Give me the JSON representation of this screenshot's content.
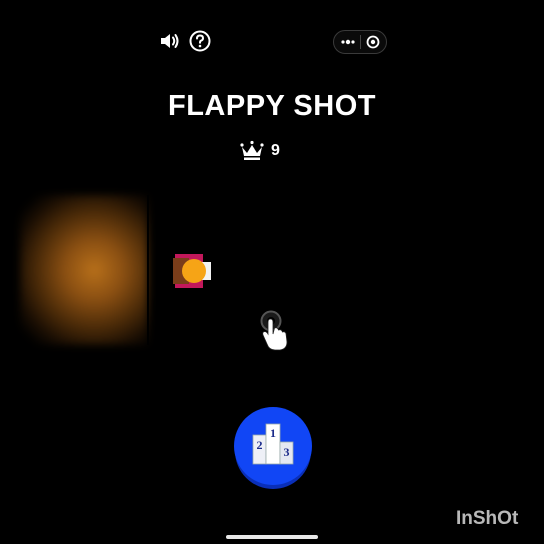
{
  "topbar": {
    "sound_icon": "speaker-icon",
    "help_icon": "question-circle-icon",
    "more_icon": "more-dots-icon",
    "close_icon": "target-close-icon"
  },
  "game": {
    "title": "FLAPPY SHOT",
    "best_icon": "crown-icon",
    "best_score": "9"
  },
  "leaderboard": {
    "icon": "podium-icon",
    "podium_numbers": [
      "2",
      "1",
      "3"
    ],
    "color": "#1146f5"
  },
  "hint": {
    "icon": "tap-hand-icon"
  },
  "player": {
    "ball_color": "#f6a416",
    "barrel_color": "#c2185b"
  },
  "watermark": {
    "text": "InShOt"
  }
}
